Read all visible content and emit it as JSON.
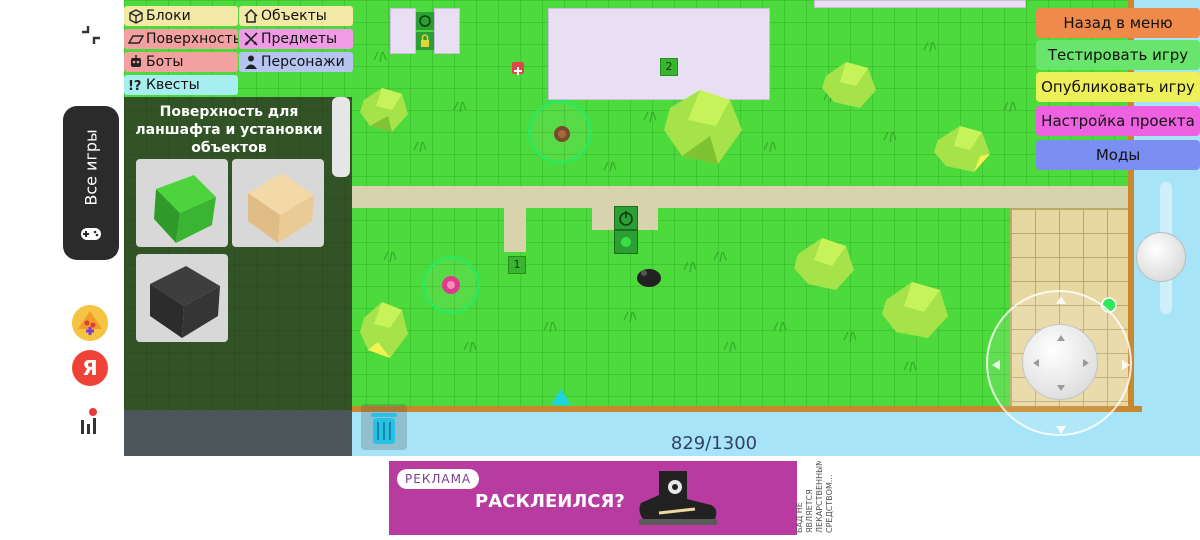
{
  "system_sidebar": {
    "all_games_label": "Все игры",
    "icons": [
      "collapse-icon",
      "gamepad-icon",
      "pizza-game-icon",
      "yandex-icon",
      "stats-icon"
    ],
    "yandex_letter": "Я"
  },
  "editor": {
    "categories": [
      {
        "label": "Блоки",
        "color": "#f2e9a6"
      },
      {
        "label": "Объекты",
        "color": "#f2e9a6"
      },
      {
        "label": "Поверхность",
        "color": "#f3a0a0"
      },
      {
        "label": "Предметы",
        "color": "#f09be6"
      },
      {
        "label": "Боты",
        "color": "#f3a0a0"
      },
      {
        "label": "Персонажи",
        "color": "#b6c5f0"
      },
      {
        "label": "Квесты",
        "color": "#a7eef0"
      }
    ],
    "surface_panel": {
      "title": "Поверхность для ланшафта и установки объектов",
      "tiles": [
        "grass-tile",
        "sand-tile",
        "asphalt-tile"
      ]
    }
  },
  "menu": {
    "back": {
      "label": "Назад в меню",
      "color": "#f08a4b"
    },
    "test": {
      "label": "Тестировать игру",
      "color": "#69e46c"
    },
    "publish": {
      "label": "Опубликовать игру",
      "color": "#eef05a"
    },
    "settings": {
      "label": "Настройка проекта",
      "color": "#ee62e2"
    },
    "mods": {
      "label": "Моды",
      "color": "#7b8ff3"
    }
  },
  "scene": {
    "markers": [
      "1",
      "2"
    ],
    "counter": "829/1300"
  },
  "ad": {
    "badge": "РЕКЛАМА",
    "headline": "РАСКЛЕИЛСЯ?",
    "disclaimer": "БАД НЕ ЯВЛЯЕТСЯ ЛЕКАРСТВЕННЫМ СРЕДСТВОМ..."
  }
}
